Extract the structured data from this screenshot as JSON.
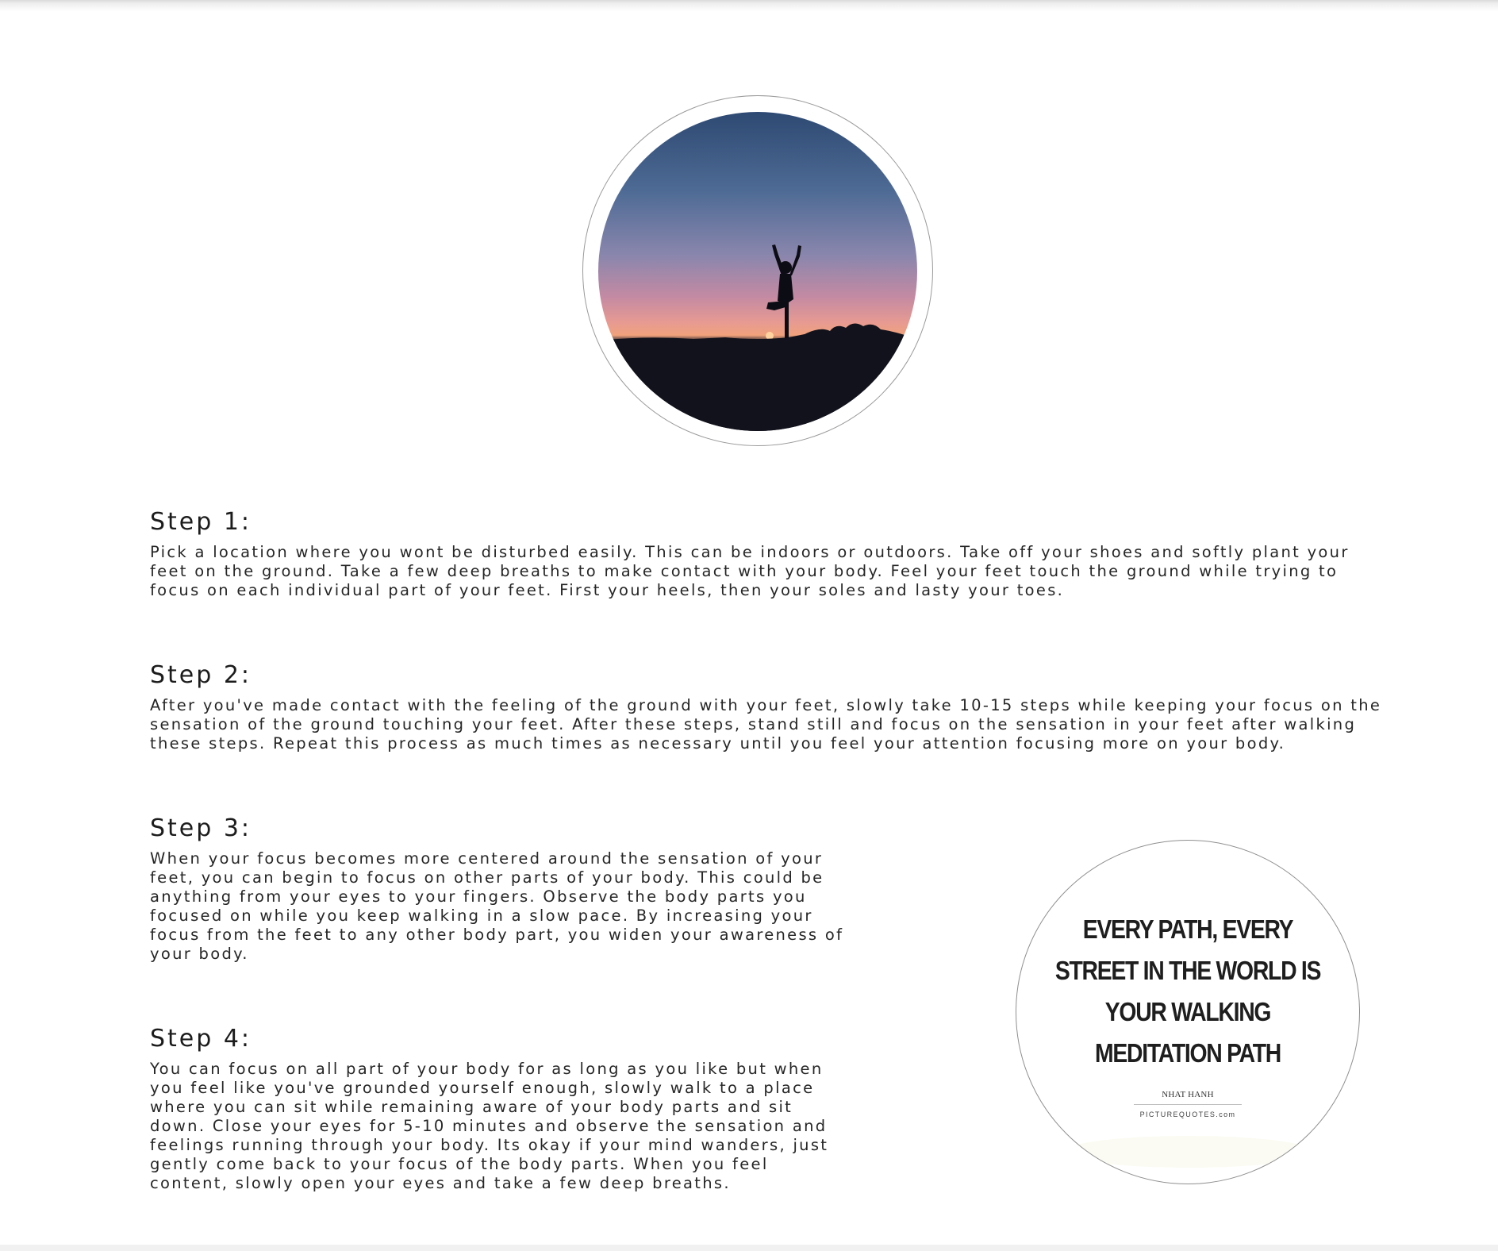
{
  "hero": {
    "image_alt": "Silhouette of a person in tree pose against a sunset sky"
  },
  "steps": [
    {
      "heading": "Step 1:",
      "body": "Pick a location where you wont be disturbed easily. This can be indoors or outdoors. Take off your shoes and softly plant your feet on the ground. Take a few deep breaths to make contact with your body. Feel your feet touch the ground while trying to focus on each individual part of your feet. First your heels, then your soles and lasty your toes."
    },
    {
      "heading": "Step 2:",
      "body": "After you've made contact with the feeling of the ground with your feet, slowly take 10-15 steps while keeping your focus on the sensation of the ground touching your feet. After these steps, stand still and focus on the sensation in your feet after walking these steps. Repeat this process as much times as necessary until you feel your attention focusing more on your body."
    },
    {
      "heading": "Step 3:",
      "body": "When your focus becomes more centered around the sensation of your feet, you can begin to focus on other parts of your body. This could be anything from your eyes to your fingers. Observe the body parts you focused on while you keep walking in a slow pace. By increasing your focus from the feet to any other body part, you widen your awareness of your body."
    },
    {
      "heading": "Step 4:",
      "body": "You can focus on all part of your body for as long as you like but when you feel like you've grounded yourself enough, slowly walk to a place where you can sit while remaining aware of your body parts and sit down. Close your eyes for 5-10 minutes and observe the sensation and feelings running through your body. Its okay if your mind wanders, just gently come back to your focus of the body parts. When you feel content, slowly open your eyes and take a few deep breaths."
    }
  ],
  "quote": {
    "text": "EVERY PATH, EVERY STREET IN THE WORLD IS YOUR WALKING MEDITATION PATH",
    "author": "NHAT HANH",
    "source": "PICTUREQUOTES.com"
  }
}
